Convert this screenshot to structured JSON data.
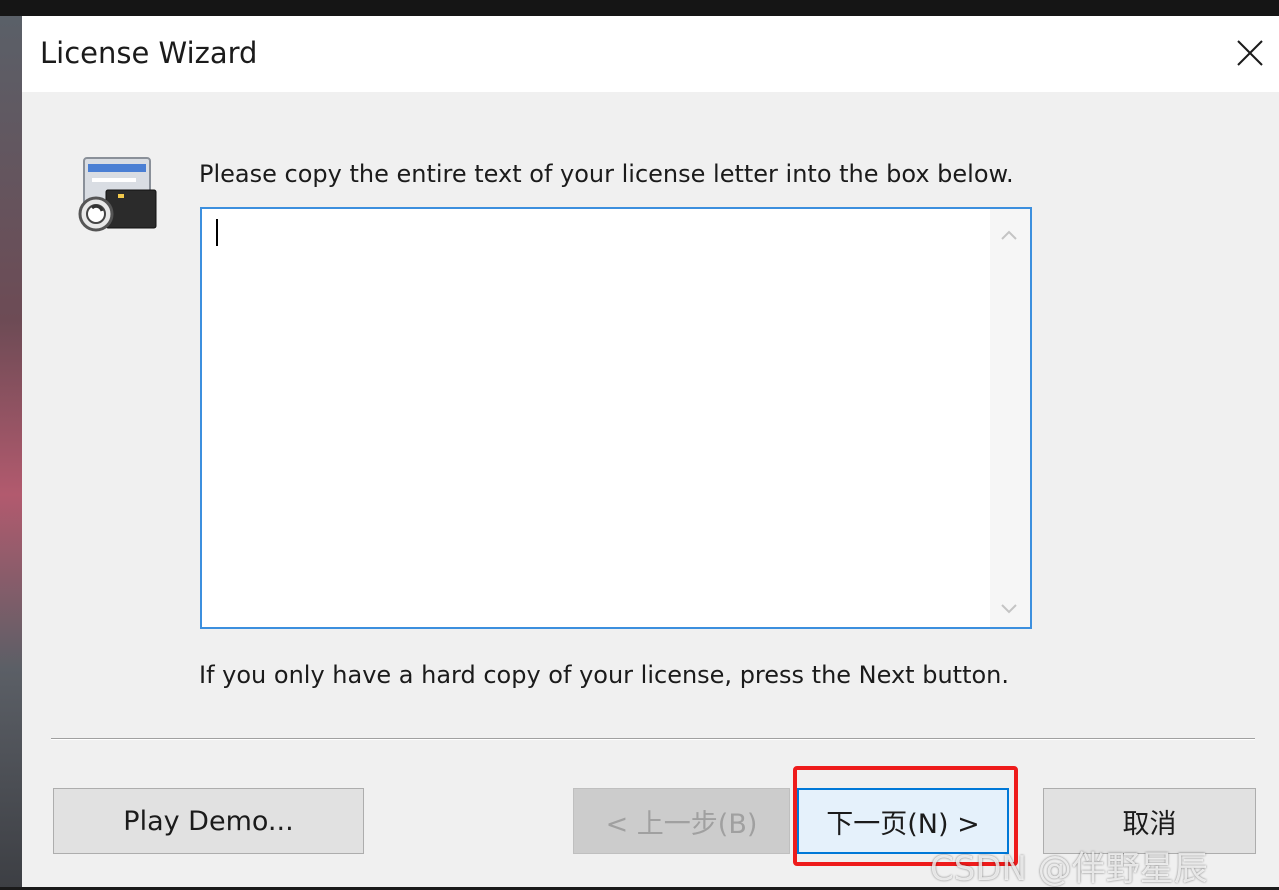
{
  "window": {
    "title": "License Wizard",
    "close_icon": "close-icon"
  },
  "content": {
    "instruction": "Please copy the entire text of your license letter into the box below.",
    "license_text": "",
    "hint": "If you only have a hard copy of your license, press the Next button."
  },
  "buttons": {
    "demo_label": "Play Demo...",
    "back_label": "< 上一步(B)",
    "next_label": "下一页(N) >",
    "cancel_label": "取消"
  },
  "watermark": "CSDN @伴野星辰",
  "colors": {
    "accent": "#0078d7",
    "highlight": "#ee1b1b",
    "focus_border": "#3c8fde"
  }
}
